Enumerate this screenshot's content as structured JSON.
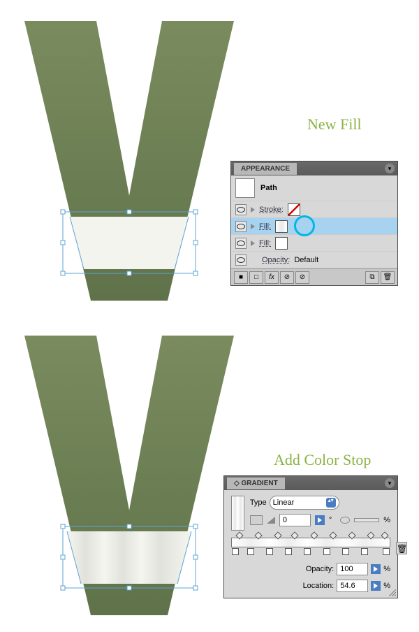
{
  "labels": {
    "newFill": "New Fill",
    "addColorStop": "Add Color Stop"
  },
  "appearance": {
    "title": "APPEARANCE",
    "path": "Path",
    "stroke": "Stroke:",
    "fill": "Fill:",
    "opacity": "Opacity:",
    "default": "Default",
    "fx": "fx"
  },
  "gradient": {
    "title": "GRADIENT",
    "typeLabel": "Type",
    "typeValue": "Linear",
    "angle": "0",
    "degree": "°",
    "aspectPct": "%",
    "opacityLabel": "Opacity:",
    "opacityValue": "100",
    "opacityPct": "%",
    "locationLabel": "Location:",
    "locationValue": "54.6",
    "locationPct": "%",
    "stops_top": [
      5,
      17,
      29,
      40,
      52,
      64,
      76,
      88,
      97
    ],
    "stops_bot": [
      2,
      12,
      24,
      36,
      48,
      60,
      72,
      84,
      98
    ]
  }
}
